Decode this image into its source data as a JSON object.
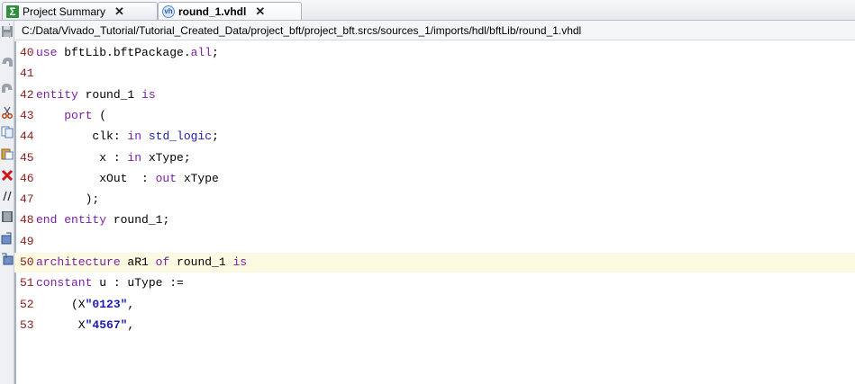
{
  "tabs": [
    {
      "label": "Project Summary",
      "icon": "sigma-icon",
      "icon_glyph": "Σ"
    },
    {
      "label": "round_1.vhdl",
      "icon": "vhdl-file-icon",
      "icon_glyph": "vh"
    }
  ],
  "close_glyph": "✕",
  "path": "C:/Data/Vivado_Tutorial/Tutorial_Created_Data/project_bft/project_bft.srcs/sources_1/imports/hdl/bftLib/round_1.vhdl",
  "toolbar": [
    "save-icon",
    "undo-icon",
    "redo-icon",
    "cut-icon",
    "copy-icon",
    "paste-icon",
    "delete-icon",
    "comment-icon",
    "align-icon",
    "insert-template-icon",
    "insert-template-2-icon"
  ],
  "highlight_line": "50",
  "lines": [
    {
      "num": "40",
      "parts": [
        [
          "kw",
          "use"
        ],
        [
          "n",
          " bftLib.bftPackage."
        ],
        [
          "kw",
          "all"
        ],
        [
          "n",
          ";"
        ]
      ]
    },
    {
      "num": "41",
      "parts": []
    },
    {
      "num": "42",
      "parts": [
        [
          "kw",
          "entity"
        ],
        [
          "n",
          " round_1 "
        ],
        [
          "kw",
          "is"
        ]
      ]
    },
    {
      "num": "43",
      "parts": [
        [
          "n",
          "    "
        ],
        [
          "kw",
          "port"
        ],
        [
          "n",
          " ("
        ]
      ]
    },
    {
      "num": "44",
      "parts": [
        [
          "n",
          "        clk: "
        ],
        [
          "kw",
          "in"
        ],
        [
          "n",
          " "
        ],
        [
          "ty",
          "std_logic"
        ],
        [
          "n",
          ";"
        ]
      ]
    },
    {
      "num": "45",
      "parts": [
        [
          "n",
          "         x : "
        ],
        [
          "kw",
          "in"
        ],
        [
          "n",
          " xType;"
        ]
      ]
    },
    {
      "num": "46",
      "parts": [
        [
          "n",
          "         xOut  : "
        ],
        [
          "kw",
          "out"
        ],
        [
          "n",
          " xType"
        ]
      ]
    },
    {
      "num": "47",
      "parts": [
        [
          "n",
          "       );"
        ]
      ]
    },
    {
      "num": "48",
      "parts": [
        [
          "kw",
          "end"
        ],
        [
          "n",
          " "
        ],
        [
          "kw",
          "entity"
        ],
        [
          "n",
          " round_1;"
        ]
      ]
    },
    {
      "num": "49",
      "parts": []
    },
    {
      "num": "50",
      "parts": [
        [
          "kw",
          "architecture"
        ],
        [
          "n",
          " aR1 "
        ],
        [
          "kw",
          "of"
        ],
        [
          "n",
          " round_1 "
        ],
        [
          "kw",
          "is"
        ]
      ]
    },
    {
      "num": "51",
      "parts": [
        [
          "kw",
          "constant"
        ],
        [
          "n",
          " u : uType :="
        ]
      ]
    },
    {
      "num": "52",
      "parts": [
        [
          "n",
          "     (X"
        ],
        [
          "st",
          "\"0123\""
        ],
        [
          "n",
          ","
        ]
      ]
    },
    {
      "num": "53",
      "parts": [
        [
          "n",
          "      X"
        ],
        [
          "st",
          "\"4567\""
        ],
        [
          "n",
          ","
        ]
      ]
    }
  ]
}
